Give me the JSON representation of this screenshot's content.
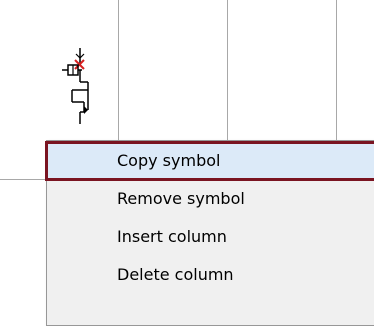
{
  "context_menu": {
    "items": [
      {
        "label": "Copy symbol",
        "highlighted": true
      },
      {
        "label": "Remove symbol",
        "highlighted": false
      },
      {
        "label": "Insert column",
        "highlighted": false
      },
      {
        "label": "Delete column",
        "highlighted": false
      }
    ]
  },
  "colors": {
    "grid_line": "#a8a8a8",
    "menu_bg": "#f0f0f0",
    "highlight_bg": "#dceaf8",
    "highlight_border": "#7a1421",
    "symbol_stroke": "#000000",
    "symbol_marker": "#d62020"
  },
  "icons": {
    "symbol": "electrical-transistor-symbol-icon"
  }
}
